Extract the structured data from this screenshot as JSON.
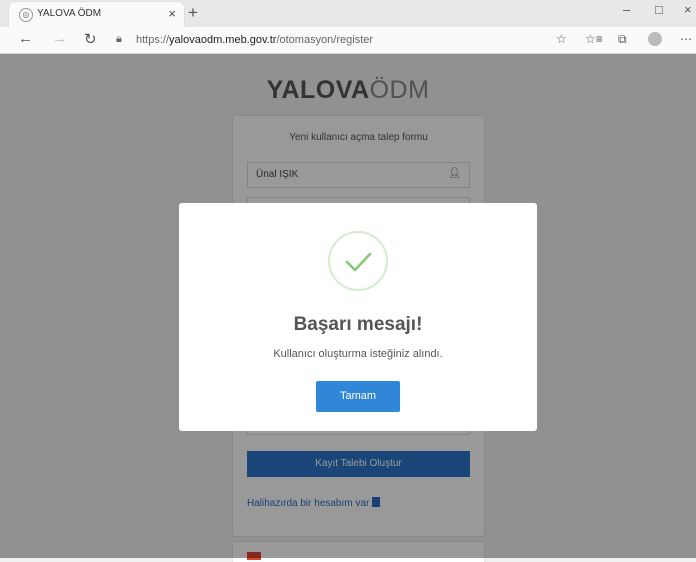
{
  "browser": {
    "tab_title": "YALOVA ÖDM",
    "tab_close": "×",
    "new_tab": "+",
    "url_prefix": "https://",
    "url_host": "yalovaodm.meb.gov.tr",
    "url_path": "/otomasyon/register",
    "window_controls": {
      "minimize": "–",
      "maximize": "□",
      "close": "×"
    }
  },
  "page": {
    "logo_bold": "YALOVA",
    "logo_light": "ÖDM",
    "form_title": "Yeni kullanıcı açma talep formu",
    "name_value": "Ünal IŞIK",
    "submit_label": "Kayıt Talebi Oluştur",
    "login_link": "Halihazırda bir hesabım var"
  },
  "modal": {
    "title": "Başarı mesajı!",
    "text": "Kullanıcı oluşturma isteğiniz alındı.",
    "button_label": "Tamam",
    "icon": "success-check-icon"
  },
  "colors": {
    "primary_button": "#3087d8",
    "submit_button": "#2b73c8",
    "success_green": "#81c96f"
  }
}
